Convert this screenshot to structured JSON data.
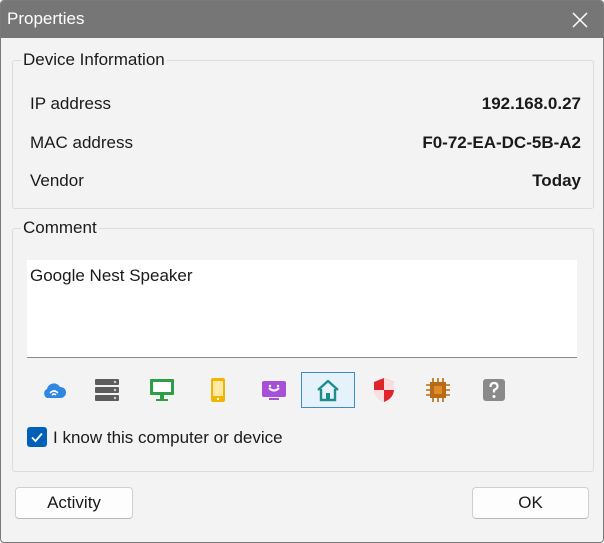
{
  "window": {
    "title": "Properties"
  },
  "device_info": {
    "label": "Device Information",
    "rows": [
      {
        "label": "IP address",
        "value": "192.168.0.27"
      },
      {
        "label": "MAC address",
        "value": "F0-72-EA-DC-5B-A2"
      },
      {
        "label": "Vendor",
        "value": "Today"
      }
    ]
  },
  "comment": {
    "label": "Comment",
    "value": "Google Nest Speaker",
    "device_types": [
      {
        "icon": "wifi-cloud-icon",
        "selected": false
      },
      {
        "icon": "server-icon",
        "selected": false
      },
      {
        "icon": "monitor-icon",
        "selected": false
      },
      {
        "icon": "phone-icon",
        "selected": false
      },
      {
        "icon": "tv-icon",
        "selected": false
      },
      {
        "icon": "home-icon",
        "selected": true
      },
      {
        "icon": "shield-icon",
        "selected": false
      },
      {
        "icon": "chip-icon",
        "selected": false
      },
      {
        "icon": "unknown-icon",
        "selected": false
      }
    ],
    "known_checkbox": {
      "label": "I know this computer or device",
      "checked": true
    }
  },
  "buttons": {
    "activity": "Activity",
    "ok": "OK"
  },
  "colors": {
    "titlebar": "#767676",
    "accent": "#005fb8",
    "selection_border": "#3a8bd0",
    "selection_fill": "#e5f1fb"
  }
}
